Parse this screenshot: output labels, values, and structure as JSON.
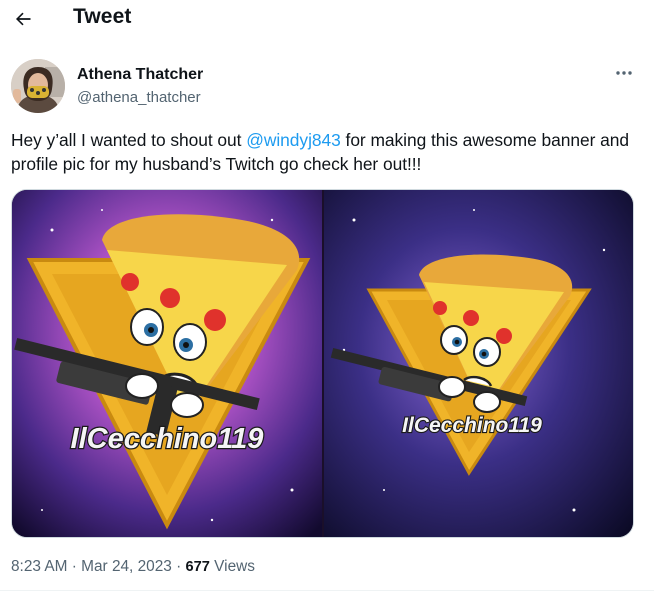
{
  "header": {
    "title": "Tweet",
    "back_icon": "arrow-left-icon"
  },
  "author": {
    "name": "Athena Thatcher",
    "handle": "@athena_thatcher"
  },
  "tweet": {
    "text_before": "Hey y’all I wanted to shout out ",
    "mention": "@windyj843",
    "text_after": " for making this awesome banner and profile pic for my husband’s Twitch go check her out!!!"
  },
  "media": {
    "images": [
      {
        "logo_text": "IlCecchino119"
      },
      {
        "logo_text": "IlCecchino119"
      }
    ]
  },
  "meta": {
    "time": "8:23 AM",
    "sep1": " · ",
    "date": "Mar 24, 2023",
    "sep2": " · ",
    "views_count": "677",
    "views_label": " Views"
  },
  "colors": {
    "text": "#0f1419",
    "secondary": "#536471",
    "link": "#1d9bf0"
  }
}
